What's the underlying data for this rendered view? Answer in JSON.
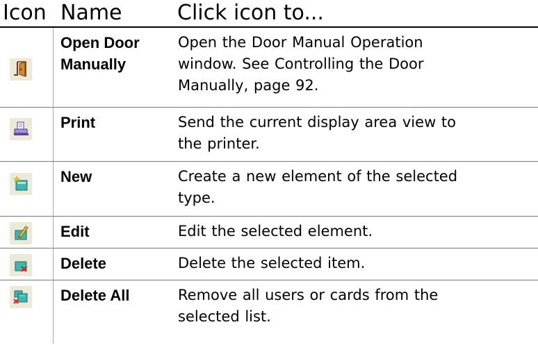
{
  "header": {
    "icon": "Icon",
    "name": "Name",
    "description": "Click icon to..."
  },
  "rows": [
    {
      "icon": "open-door-icon",
      "name_lines": [
        "Open Door",
        "Manually"
      ],
      "desc_lines": [
        "Open the Door Manual Operation",
        "window. See Controlling the Door",
        "Manually, page 92."
      ]
    },
    {
      "icon": "print-icon",
      "name_lines": [
        "Print"
      ],
      "desc_lines": [
        "Send the current display area view to",
        "the printer."
      ]
    },
    {
      "icon": "new-icon",
      "name_lines": [
        "New"
      ],
      "desc_lines": [
        "Create a new element of the selected",
        "type."
      ]
    },
    {
      "icon": "edit-icon",
      "name_lines": [
        "Edit"
      ],
      "desc_lines": [
        "Edit the selected element."
      ]
    },
    {
      "icon": "delete-icon",
      "name_lines": [
        "Delete"
      ],
      "desc_lines": [
        "Delete the selected item."
      ]
    },
    {
      "icon": "delete-all-icon",
      "name_lines": [
        "Delete All"
      ],
      "desc_lines": [
        "Remove all users or cards from the",
        "selected list."
      ]
    }
  ],
  "colors": {
    "icon_background": "#ece9d8",
    "rule": "#777777"
  }
}
